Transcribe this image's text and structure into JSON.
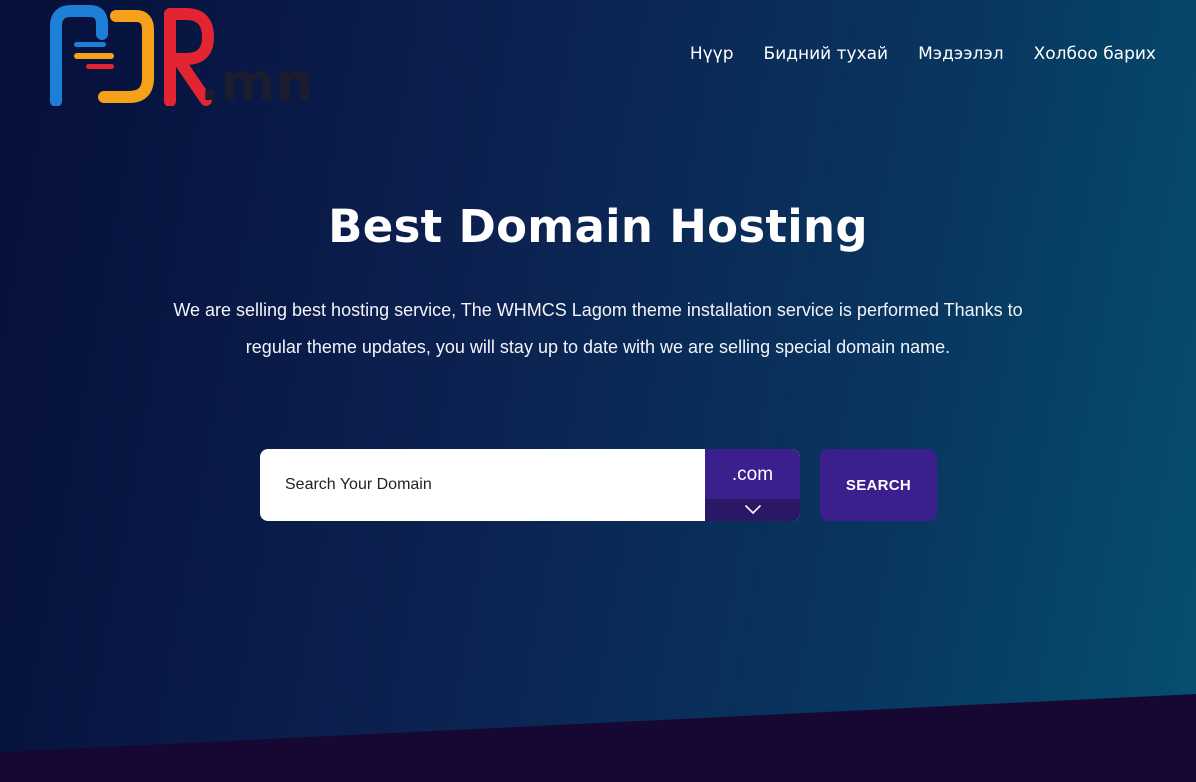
{
  "header": {
    "logo_text": ".mn",
    "nav": [
      {
        "label": "Нүүр"
      },
      {
        "label": "Бидний тухай"
      },
      {
        "label": "Мэдээлэл"
      },
      {
        "label": "Холбоо барих"
      }
    ]
  },
  "hero": {
    "title": "Best Domain Hosting",
    "description": "We are selling best hosting service, The WHMCS Lagom theme installation service is performed Thanks to regular theme updates, you will stay up to date with we are selling special domain name."
  },
  "search": {
    "placeholder": "Search Your Domain",
    "value": "",
    "tld_selected": ".com",
    "button_label": "SEARCH"
  },
  "colors": {
    "background_start": "#060f3a",
    "background_end": "#05506f",
    "accent": "#3b1f8c",
    "accent_dark": "#2a1766",
    "bottom_band": "#170833",
    "logo_blue": "#1d7fd6",
    "logo_orange": "#f7a11a",
    "logo_red": "#e32532"
  }
}
